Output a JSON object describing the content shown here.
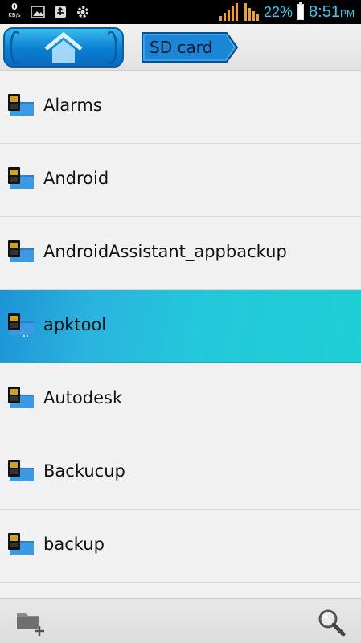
{
  "status_bar": {
    "net_speed_value": "0",
    "net_speed_unit": "KB/s",
    "left_icons": [
      "image-icon",
      "usb-icon",
      "settings-icon"
    ],
    "signal_icon": "signal-bars-icon",
    "battery_percent": "22%",
    "time": "8:51",
    "ampm": "PM",
    "accent_color": "#35c8f0"
  },
  "nav": {
    "home_icon": "home-icon",
    "breadcrumb": "SD card"
  },
  "folders": [
    {
      "label": "Alarms",
      "selected": false
    },
    {
      "label": "Android",
      "selected": false
    },
    {
      "label": "AndroidAssistant_appbackup",
      "selected": false
    },
    {
      "label": "apktool",
      "selected": true
    },
    {
      "label": "Autodesk",
      "selected": false
    },
    {
      "label": "Backucup",
      "selected": false
    },
    {
      "label": "backup",
      "selected": false
    }
  ],
  "toolbar": {
    "new_folder_icon": "new-folder-icon",
    "search_icon": "search-icon"
  }
}
